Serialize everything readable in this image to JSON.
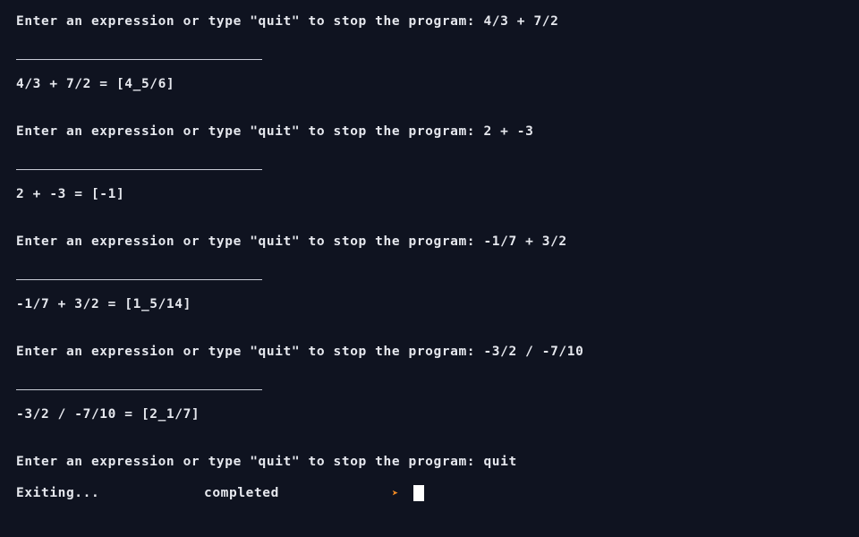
{
  "session": {
    "blocks": [
      {
        "prompt": "Enter an expression or type \"quit\" to stop the program: 4/3 + 7/2",
        "result": "4/3 + 7/2 = [4_5/6]"
      },
      {
        "prompt": "Enter an expression or type \"quit\" to stop the program: 2 + -3",
        "result": "2 + -3 = [-1]"
      },
      {
        "prompt": "Enter an expression or type \"quit\" to stop the program: -1/7 + 3/2",
        "result": "-1/7 + 3/2 = [1_5/14]"
      },
      {
        "prompt": "Enter an expression or type \"quit\" to stop the program: -3/2 / -7/10",
        "result": "-3/2 / -7/10 = [2_1/7]"
      }
    ],
    "final_prompt": "Enter an expression or type \"quit\" to stop the program: quit",
    "exit_message": "Exiting...",
    "status": "completed"
  },
  "icons": {
    "prompt_arrow": "chevron-right-icon",
    "cursor": "block-cursor"
  },
  "colors": {
    "background": "#0f1320",
    "text": "#e6e8ee",
    "prompt_arrow": "#f08a24",
    "cursor": "#ffffff"
  }
}
